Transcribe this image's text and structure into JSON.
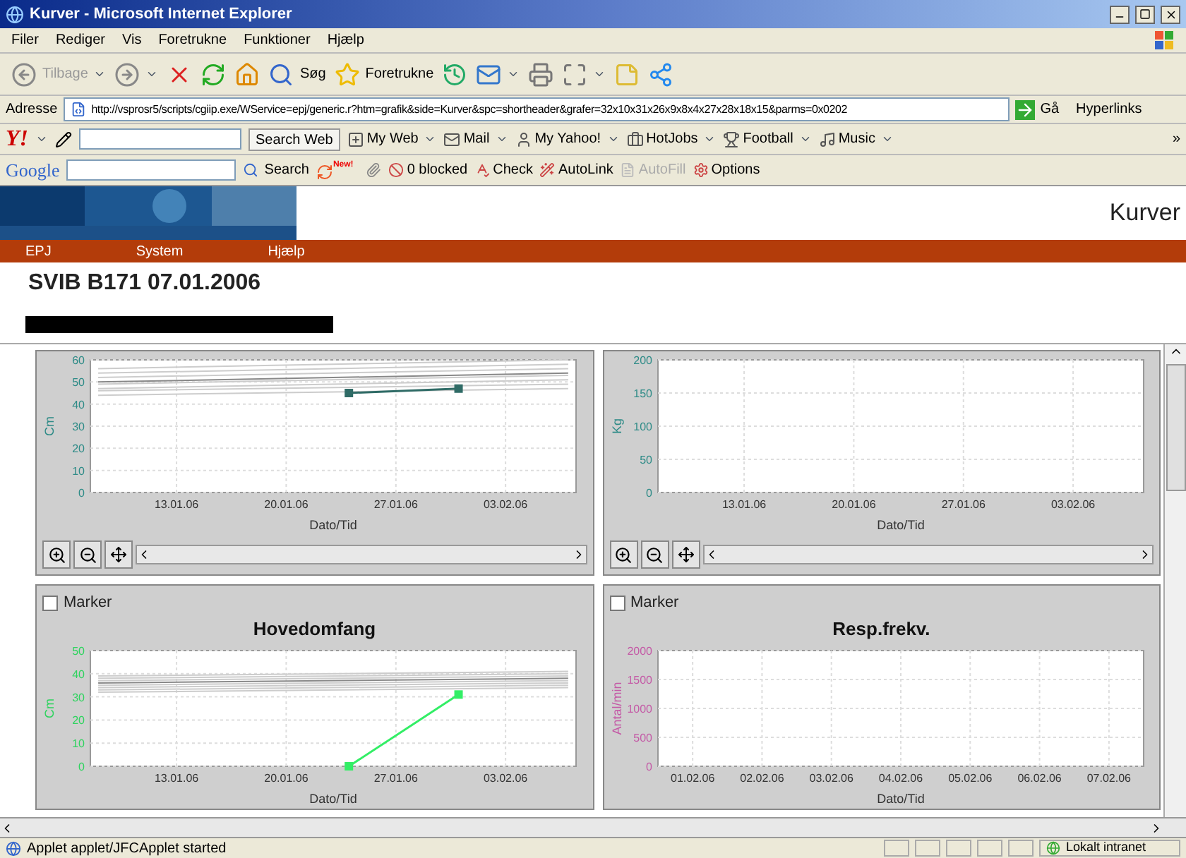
{
  "window": {
    "title": "Kurver - Microsoft Internet Explorer"
  },
  "menu": [
    "Filer",
    "Rediger",
    "Vis",
    "Foretrukne",
    "Funktioner",
    "Hjælp"
  ],
  "toolbar": [
    {
      "kind": "back",
      "label": "Tilbage",
      "dropdown": true
    },
    {
      "kind": "forward",
      "dropdown": true
    },
    {
      "kind": "stop",
      "dropdown": false
    },
    {
      "kind": "refresh",
      "dropdown": false
    },
    {
      "kind": "home",
      "dropdown": false
    },
    {
      "kind": "search",
      "label": "Søg",
      "dropdown": false
    },
    {
      "kind": "favorites",
      "label": "Foretrukne",
      "dropdown": false
    },
    {
      "kind": "history",
      "dropdown": false
    },
    {
      "kind": "mail",
      "dropdown": true
    },
    {
      "kind": "print",
      "dropdown": false
    },
    {
      "kind": "fullscreen",
      "dropdown": true
    },
    {
      "kind": "note",
      "dropdown": false
    },
    {
      "kind": "share",
      "dropdown": false
    }
  ],
  "address": {
    "label": "Adresse",
    "url": "http://vsprosr5/scripts/cgiip.exe/WService=epj/generic.r?htm=grafik&side=Kurver&spc=shortheader&grafer=32x10x31x26x9x8x4x27x28x18x15&parms=0x0202",
    "go": "Gå",
    "links": "Hyperlinks"
  },
  "yahoo_toolbar": {
    "logo": "Y!",
    "search_button": "Search Web",
    "items": [
      "My Web",
      "Mail",
      "My Yahoo!",
      "HotJobs",
      "Football",
      "Music"
    ],
    "more": "»"
  },
  "google_toolbar": {
    "logo": "Google",
    "search_button": "Search",
    "badge": "New!",
    "items": [
      {
        "label": "0 blocked",
        "disabled": false
      },
      {
        "label": "Check",
        "disabled": false
      },
      {
        "label": "AutoLink",
        "disabled": false
      },
      {
        "label": "AutoFill",
        "disabled": true
      },
      {
        "label": "Options",
        "disabled": false
      }
    ]
  },
  "page": {
    "banner_title": "Kurver",
    "nav": [
      "EPJ",
      "System",
      "Hjælp"
    ],
    "heading": "SVIB B171 07.01.2006"
  },
  "charts": [
    {
      "color": "#2e8b87",
      "zoom_toolbar": true,
      "chart_data": {
        "type": "line",
        "grid": true,
        "xlabel": "Dato/Tid",
        "ylabel": "Cm",
        "ylim": [
          0,
          60
        ],
        "yticks": [
          0,
          10,
          20,
          30,
          40,
          50,
          60
        ],
        "categories": [
          null,
          null,
          null,
          null,
          null,
          "13.01.06",
          null,
          null,
          null,
          null,
          null,
          null,
          "20.01.06",
          null,
          null,
          null,
          null,
          null,
          null,
          "27.01.06",
          null,
          null,
          null,
          null,
          null,
          null,
          "03.02.06",
          null,
          null,
          null,
          null
        ],
        "series": [
          {
            "color": "#cccccc",
            "values": [
              44,
              null,
              null,
              null,
              null,
              null,
              null,
              null,
              null,
              null,
              null,
              null,
              null,
              null,
              null,
              null,
              null,
              null,
              null,
              null,
              null,
              null,
              null,
              null,
              null,
              null,
              null,
              null,
              null,
              null,
              47
            ]
          },
          {
            "color": "#cccccc",
            "values": [
              46,
              null,
              null,
              null,
              null,
              null,
              null,
              null,
              null,
              null,
              null,
              null,
              null,
              null,
              null,
              null,
              null,
              null,
              null,
              null,
              null,
              null,
              null,
              null,
              null,
              null,
              null,
              null,
              null,
              null,
              49
            ]
          },
          {
            "color": "#cccccc",
            "values": [
              47,
              null,
              null,
              null,
              null,
              null,
              null,
              null,
              null,
              null,
              null,
              null,
              null,
              null,
              null,
              null,
              null,
              null,
              null,
              null,
              null,
              null,
              null,
              null,
              null,
              null,
              null,
              null,
              null,
              null,
              51
            ]
          },
          {
            "color": "#cccccc",
            "values": [
              49,
              null,
              null,
              null,
              null,
              null,
              null,
              null,
              null,
              null,
              null,
              null,
              null,
              null,
              null,
              null,
              null,
              null,
              null,
              null,
              null,
              null,
              null,
              null,
              null,
              null,
              null,
              null,
              null,
              null,
              53
            ]
          },
          {
            "color": "#888888",
            "values": [
              50,
              null,
              null,
              null,
              null,
              null,
              null,
              null,
              null,
              null,
              null,
              null,
              null,
              null,
              null,
              null,
              null,
              null,
              null,
              null,
              null,
              null,
              null,
              null,
              null,
              null,
              null,
              null,
              null,
              null,
              54
            ]
          },
          {
            "color": "#cccccc",
            "values": [
              52,
              null,
              null,
              null,
              null,
              null,
              null,
              null,
              null,
              null,
              null,
              null,
              null,
              null,
              null,
              null,
              null,
              null,
              null,
              null,
              null,
              null,
              null,
              null,
              null,
              null,
              null,
              null,
              null,
              null,
              56
            ]
          },
          {
            "color": "#cccccc",
            "values": [
              54,
              null,
              null,
              null,
              null,
              null,
              null,
              null,
              null,
              null,
              null,
              null,
              null,
              null,
              null,
              null,
              null,
              null,
              null,
              null,
              null,
              null,
              null,
              null,
              null,
              null,
              null,
              null,
              null,
              null,
              58
            ]
          },
          {
            "color": "#cccccc",
            "values": [
              56,
              null,
              null,
              null,
              null,
              null,
              null,
              null,
              null,
              null,
              null,
              null,
              null,
              null,
              null,
              null,
              null,
              null,
              null,
              null,
              null,
              null,
              null,
              null,
              null,
              null,
              null,
              null,
              null,
              null,
              60
            ]
          },
          {
            "color": "#2f6b66",
            "marker": "square",
            "values": [
              null,
              null,
              null,
              null,
              null,
              null,
              null,
              null,
              null,
              null,
              null,
              null,
              null,
              null,
              null,
              null,
              45,
              null,
              null,
              null,
              null,
              null,
              null,
              47,
              null,
              null,
              null,
              null,
              null,
              null,
              null
            ]
          }
        ]
      }
    },
    {
      "color": "#2e8b87",
      "zoom_toolbar": true,
      "chart_data": {
        "type": "line",
        "grid": true,
        "xlabel": "Dato/Tid",
        "ylabel": "Kg",
        "ylim": [
          0,
          200
        ],
        "yticks": [
          0,
          50,
          100,
          150,
          200
        ],
        "categories": [
          null,
          null,
          null,
          null,
          null,
          "13.01.06",
          null,
          null,
          null,
          null,
          null,
          null,
          "20.01.06",
          null,
          null,
          null,
          null,
          null,
          null,
          "27.01.06",
          null,
          null,
          null,
          null,
          null,
          null,
          "03.02.06",
          null,
          null,
          null,
          null
        ]
      }
    },
    {
      "color": "#2fd35f",
      "zoom_toolbar": false,
      "marker": {
        "label": "Marker",
        "checked": false
      },
      "chart_data": {
        "type": "line",
        "grid": true,
        "title": "Hovedomfang",
        "xlabel": "Dato/Tid",
        "ylabel": "Cm",
        "ylim": [
          0,
          50
        ],
        "yticks": [
          0,
          10,
          20,
          30,
          40,
          50
        ],
        "categories": [
          null,
          null,
          null,
          null,
          null,
          "13.01.06",
          null,
          null,
          null,
          null,
          null,
          null,
          "20.01.06",
          null,
          null,
          null,
          null,
          null,
          null,
          "27.01.06",
          null,
          null,
          null,
          null,
          null,
          null,
          "03.02.06",
          null,
          null,
          null,
          null
        ],
        "series": [
          {
            "color": "#cccccc",
            "values": [
              32,
              null,
              null,
              null,
              null,
              null,
              null,
              null,
              null,
              null,
              null,
              null,
              null,
              null,
              null,
              null,
              null,
              null,
              null,
              null,
              null,
              null,
              null,
              null,
              null,
              null,
              null,
              null,
              null,
              null,
              34
            ]
          },
          {
            "color": "#cccccc",
            "values": [
              33,
              null,
              null,
              null,
              null,
              null,
              null,
              null,
              null,
              null,
              null,
              null,
              null,
              null,
              null,
              null,
              null,
              null,
              null,
              null,
              null,
              null,
              null,
              null,
              null,
              null,
              null,
              null,
              null,
              null,
              35
            ]
          },
          {
            "color": "#cccccc",
            "values": [
              34,
              null,
              null,
              null,
              null,
              null,
              null,
              null,
              null,
              null,
              null,
              null,
              null,
              null,
              null,
              null,
              null,
              null,
              null,
              null,
              null,
              null,
              null,
              null,
              null,
              null,
              null,
              null,
              null,
              null,
              36
            ]
          },
          {
            "color": "#cccccc",
            "values": [
              35,
              null,
              null,
              null,
              null,
              null,
              null,
              null,
              null,
              null,
              null,
              null,
              null,
              null,
              null,
              null,
              null,
              null,
              null,
              null,
              null,
              null,
              null,
              null,
              null,
              null,
              null,
              null,
              null,
              null,
              37
            ]
          },
          {
            "color": "#888888",
            "values": [
              36,
              null,
              null,
              null,
              null,
              null,
              null,
              null,
              null,
              null,
              null,
              null,
              null,
              null,
              null,
              null,
              null,
              null,
              null,
              null,
              null,
              null,
              null,
              null,
              null,
              null,
              null,
              null,
              null,
              null,
              38
            ]
          },
          {
            "color": "#cccccc",
            "values": [
              37,
              null,
              null,
              null,
              null,
              null,
              null,
              null,
              null,
              null,
              null,
              null,
              null,
              null,
              null,
              null,
              null,
              null,
              null,
              null,
              null,
              null,
              null,
              null,
              null,
              null,
              null,
              null,
              null,
              null,
              39
            ]
          },
          {
            "color": "#cccccc",
            "values": [
              38,
              null,
              null,
              null,
              null,
              null,
              null,
              null,
              null,
              null,
              null,
              null,
              null,
              null,
              null,
              null,
              null,
              null,
              null,
              null,
              null,
              null,
              null,
              null,
              null,
              null,
              null,
              null,
              null,
              null,
              40
            ]
          },
          {
            "color": "#cccccc",
            "values": [
              39,
              null,
              null,
              null,
              null,
              null,
              null,
              null,
              null,
              null,
              null,
              null,
              null,
              null,
              null,
              null,
              null,
              null,
              null,
              null,
              null,
              null,
              null,
              null,
              null,
              null,
              null,
              null,
              null,
              null,
              41
            ]
          },
          {
            "color": "#33ee66",
            "marker": "square",
            "values": [
              null,
              null,
              null,
              null,
              null,
              null,
              null,
              null,
              null,
              null,
              null,
              null,
              null,
              null,
              null,
              null,
              0,
              null,
              null,
              null,
              null,
              null,
              null,
              31,
              null,
              null,
              null,
              null,
              null,
              null,
              null
            ]
          }
        ]
      }
    },
    {
      "color": "#c45aa6",
      "zoom_toolbar": false,
      "marker": {
        "label": "Marker",
        "checked": false
      },
      "chart_data": {
        "type": "line",
        "grid": true,
        "title": "Resp.frekv.",
        "xlabel": "Dato/Tid",
        "ylabel": "Antal/min",
        "ylim": [
          0,
          2000
        ],
        "yticks": [
          0,
          500,
          1000,
          1500,
          2000
        ],
        "categories": [
          "01.02.06",
          "02.02.06",
          "03.02.06",
          "04.02.06",
          "05.02.06",
          "06.02.06",
          "07.02.06"
        ]
      }
    }
  ],
  "status_bar": {
    "text": "Applet applet/JFCApplet started",
    "zone": "Lokalt intranet"
  }
}
